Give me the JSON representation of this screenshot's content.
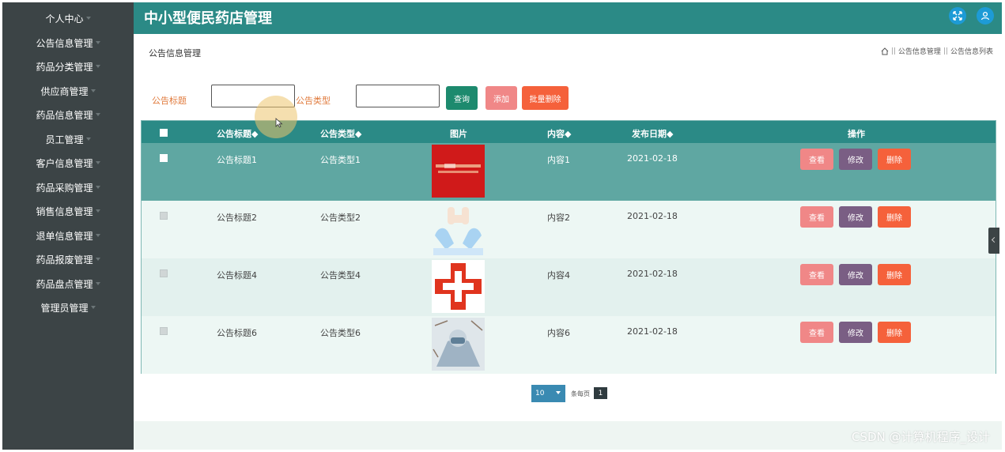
{
  "app_title": "中小型便民药店管理",
  "sidebar": {
    "items": [
      {
        "label": "个人中心"
      },
      {
        "label": "公告信息管理"
      },
      {
        "label": "药品分类管理"
      },
      {
        "label": "供应商管理"
      },
      {
        "label": "药品信息管理"
      },
      {
        "label": "员工管理"
      },
      {
        "label": "客户信息管理"
      },
      {
        "label": "药品采购管理"
      },
      {
        "label": "销售信息管理"
      },
      {
        "label": "退单信息管理"
      },
      {
        "label": "药品报废管理"
      },
      {
        "label": "药品盘点管理"
      },
      {
        "label": "管理员管理"
      }
    ]
  },
  "header": {
    "fullscreen_icon": "expand-icon",
    "user_icon": "user-icon",
    "accent": "#2b8a86"
  },
  "page": {
    "title": "公告信息管理",
    "breadcrumb": {
      "home_icon": "home-icon",
      "separator": "||",
      "items": [
        "公告信息管理",
        "公告信息列表"
      ]
    }
  },
  "search": {
    "title_label": "公告标题",
    "title_value": "",
    "type_label": "公告类型",
    "type_value": "",
    "query_button": "查询",
    "add_button": "添加",
    "batch_delete_button": "批量删除"
  },
  "table": {
    "columns": [
      "公告标题◆",
      "公告类型◆",
      "图片",
      "内容◆",
      "发布日期◆",
      "操作"
    ],
    "rows": [
      {
        "title": "公告标题1",
        "type": "公告类型1",
        "image": "red-banner-image",
        "content": "内容1",
        "date": "2021-02-18"
      },
      {
        "title": "公告标题2",
        "type": "公告类型2",
        "image": "hands-heart-image",
        "content": "内容2",
        "date": "2021-02-18"
      },
      {
        "title": "公告标题4",
        "type": "公告类型4",
        "image": "red-cross-image",
        "content": "内容4",
        "date": "2021-02-18"
      },
      {
        "title": "公告标题6",
        "type": "公告类型6",
        "image": "medical-worker-image",
        "content": "内容6",
        "date": "2021-02-18"
      }
    ],
    "actions": {
      "view": "查看",
      "edit": "修改",
      "delete": "删除"
    }
  },
  "pagination": {
    "page_size": "10",
    "per_page_text": "条每页",
    "current_page": "1"
  },
  "watermark": "CSDN @计算机程序_设计",
  "colors": {
    "sidebar": "#3c4446",
    "query": "#1d8a6e",
    "add": "#f08787",
    "batch_delete": "#f5613b",
    "edit": "#7a5e84"
  }
}
